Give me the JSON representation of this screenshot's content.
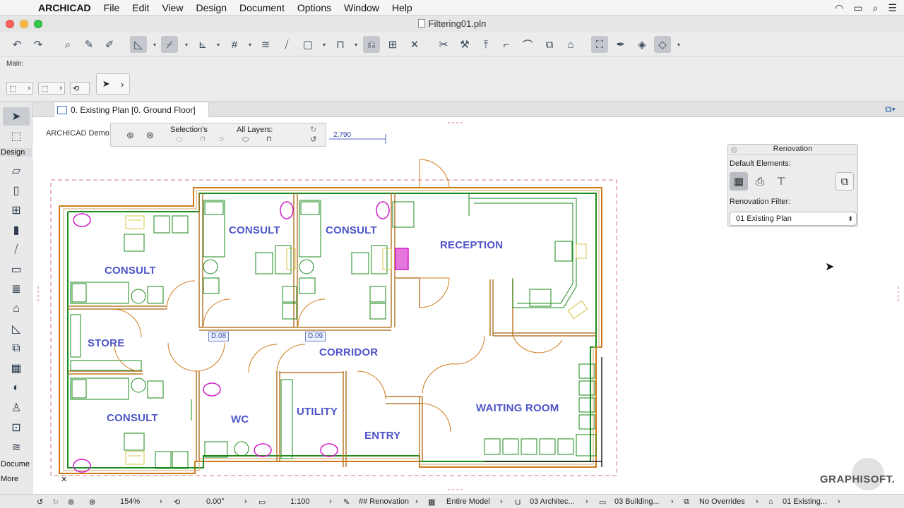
{
  "menubar": {
    "apple": "",
    "app_name": "ARCHICAD",
    "items": [
      "File",
      "Edit",
      "View",
      "Design",
      "Document",
      "Options",
      "Window",
      "Help"
    ]
  },
  "window": {
    "title": "Filtering01.pln"
  },
  "toolbar": {
    "main_label": "Main:"
  },
  "toolbox": {
    "design_label": "Design",
    "document_label": "Docume",
    "more_label": "More"
  },
  "tab": {
    "label": "0. Existing Plan [0. Ground Floor]"
  },
  "canvas": {
    "demo_label": "ARCHICAD Demo",
    "filter_bar": {
      "selection_label": "Selection's",
      "all_layers_label": "All Layers:"
    },
    "dimension_value": "2,790",
    "rooms": {
      "consult_1": "CONSULT",
      "consult_2": "CONSULT",
      "consult_3": "CONSULT",
      "consult_4": "CONSULT",
      "reception": "RECEPTION",
      "store": "STORE",
      "corridor": "CORRIDOR",
      "wc": "WC",
      "utility": "UTILITY",
      "entry": "ENTRY",
      "waiting": "WAITING ROOM"
    },
    "door_tags": {
      "d08": "D.08",
      "d09": "D.09"
    },
    "watermark": "GRAPHISOFT."
  },
  "renovation": {
    "title": "Renovation",
    "default_elements_label": "Default Elements:",
    "filter_label": "Renovation Filter:",
    "filter_value": "01 Existing Plan"
  },
  "statusbar": {
    "zoom": "154%",
    "angle": "0.00°",
    "scale": "1:100",
    "pen_set": "## Renovation",
    "model_view": "Entire Model",
    "layer_combo": "03 Architec...",
    "dimension": "03 Building...",
    "overrides": "No Overrides",
    "reno_filter": "01 Existing..."
  },
  "colors": {
    "wall_green": "#1a8a1a",
    "wall_orange": "#d07a1a",
    "magenta": "#d21bc8",
    "room_text": "#4d55c8",
    "boundary_dash": "#d47a7a"
  }
}
